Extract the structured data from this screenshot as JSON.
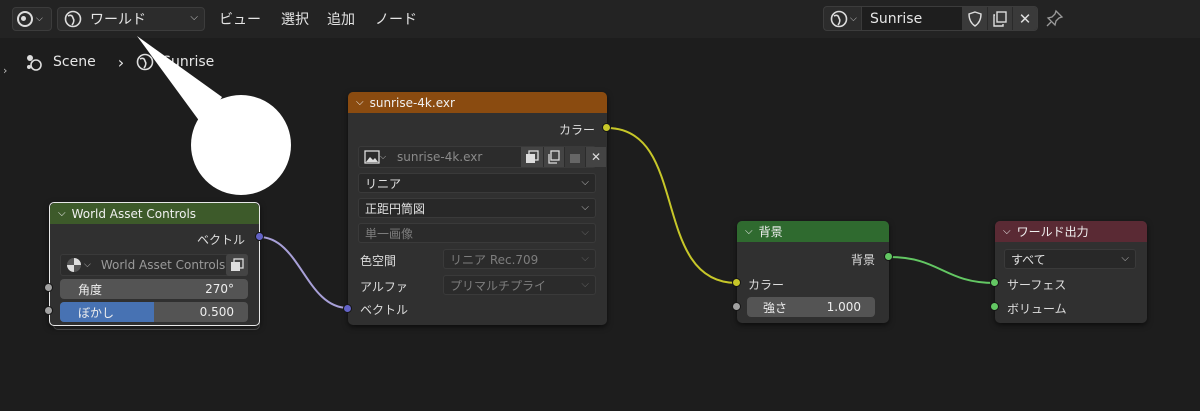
{
  "header": {
    "world_label": "ワールド",
    "menus": [
      "ビュー",
      "選択",
      "追加",
      "ノード"
    ],
    "world_name": "Sunrise"
  },
  "breadcrumb": {
    "scene": "Scene",
    "world": "Sunrise"
  },
  "nodes": {
    "world_asset": {
      "title": "World Asset Controls",
      "output": "ベクトル",
      "group_name": "World Asset Controls",
      "angle_label": "角度",
      "angle_value": "270°",
      "blur_label": "ぼかし",
      "blur_value": "0.500",
      "blur_fraction": 0.5
    },
    "image": {
      "title": "sunrise-4k.exr",
      "output": "カラー",
      "image_name": "sunrise-4k.exr",
      "interpolation": "リニア",
      "projection": "正距円筒図",
      "source": "単一画像",
      "colorspace_label": "色空間",
      "colorspace_value": "リニア Rec.709",
      "alpha_label": "アルファ",
      "alpha_value": "プリマルチプライ",
      "input": "ベクトル"
    },
    "background": {
      "title": "背景",
      "output": "背景",
      "input_color": "カラー",
      "strength_label": "強さ",
      "strength_value": "1.000"
    },
    "world_output": {
      "title": "ワールド出力",
      "target": "すべて",
      "surface": "サーフェス",
      "volume": "ボリューム"
    }
  },
  "colors": {
    "image_header": "#8a4b10",
    "group_header": "#3d5a2a",
    "background_header": "#2f6a2f",
    "output_header": "#5a2a34",
    "socket_color": "#c7c729",
    "socket_vector": "#6363c7",
    "socket_shader": "#63c763",
    "socket_float": "#a1a1a1"
  }
}
